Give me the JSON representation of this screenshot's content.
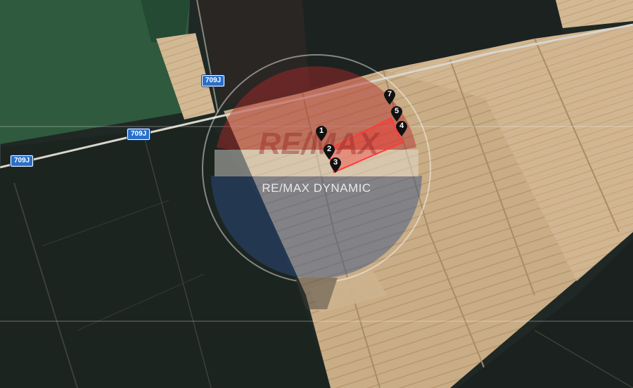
{
  "map": {
    "type": "satellite",
    "roads": [
      {
        "label": "709J"
      },
      {
        "label": "709J"
      },
      {
        "label": "709J"
      }
    ],
    "parcel": {
      "color": "#ff3b3b"
    },
    "markers": [
      {
        "label": "1"
      },
      {
        "label": "2"
      },
      {
        "label": "3"
      },
      {
        "label": "4"
      },
      {
        "label": "5"
      },
      {
        "label": "7"
      }
    ]
  },
  "watermark": {
    "logo_text": "RE/MAX",
    "caption": "RE/MAX DYNAMIC",
    "colors": {
      "red": "#b22a2a",
      "blue": "#2d4f8a",
      "white": "#ffffff"
    }
  }
}
